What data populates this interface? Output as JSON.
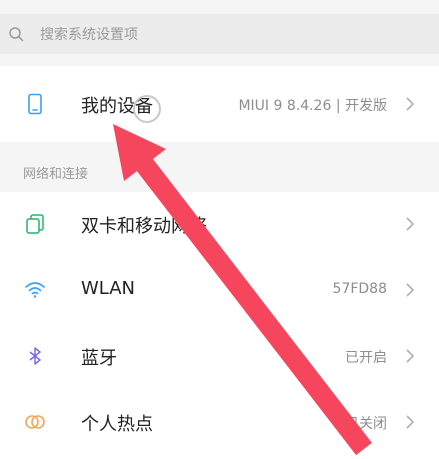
{
  "search": {
    "placeholder": "搜索系统设置项",
    "icon": "search-icon"
  },
  "device": {
    "title": "我的设备",
    "value": "MIUI 9 8.4.26 | 开发版",
    "icon": "phone-icon"
  },
  "section": {
    "label": "网络和连接"
  },
  "items": [
    {
      "title": "双卡和移动网络",
      "value": "",
      "icon": "dual-sim-icon"
    },
    {
      "title": "WLAN",
      "value": "57FD88",
      "icon": "wifi-icon"
    },
    {
      "title": "蓝牙",
      "value": "已开启",
      "icon": "bluetooth-icon"
    },
    {
      "title": "个人热点",
      "value": "已关闭",
      "icon": "hotspot-icon"
    }
  ],
  "colors": {
    "accent": "#3aa0ff",
    "dual_sim": "#24b36b",
    "bluetooth": "#7b68ee",
    "hotspot": "#f2a65a",
    "annotation_arrow": "#f5465e"
  }
}
